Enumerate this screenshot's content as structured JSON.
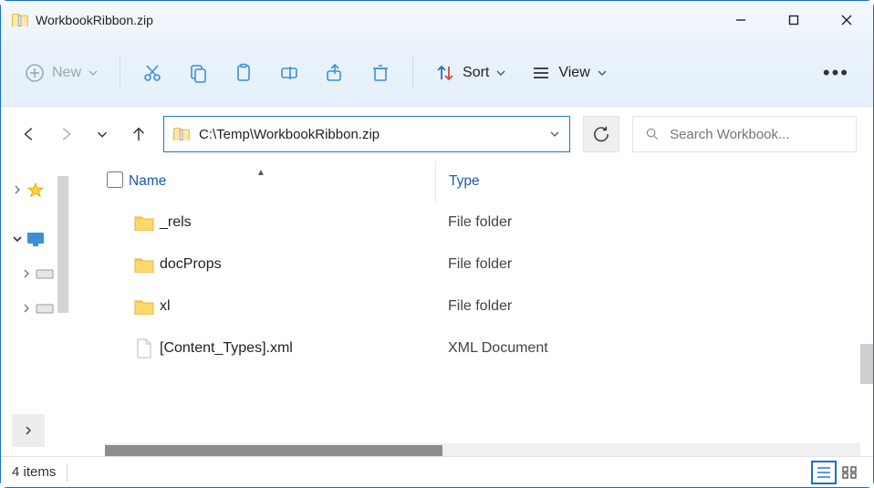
{
  "window": {
    "title": "WorkbookRibbon.zip"
  },
  "ribbon": {
    "new_label": "New",
    "sort_label": "Sort",
    "view_label": "View"
  },
  "nav": {
    "path": "C:\\Temp\\WorkbookRibbon.zip",
    "search_placeholder": "Search Workbook..."
  },
  "columns": {
    "name": "Name",
    "type": "Type"
  },
  "rows": [
    {
      "name": "_rels",
      "type": "File folder",
      "kind": "folder"
    },
    {
      "name": "docProps",
      "type": "File folder",
      "kind": "folder"
    },
    {
      "name": "xl",
      "type": "File folder",
      "kind": "folder"
    },
    {
      "name": "[Content_Types].xml",
      "type": "XML Document",
      "kind": "file"
    }
  ],
  "status": {
    "items": "4 items"
  }
}
